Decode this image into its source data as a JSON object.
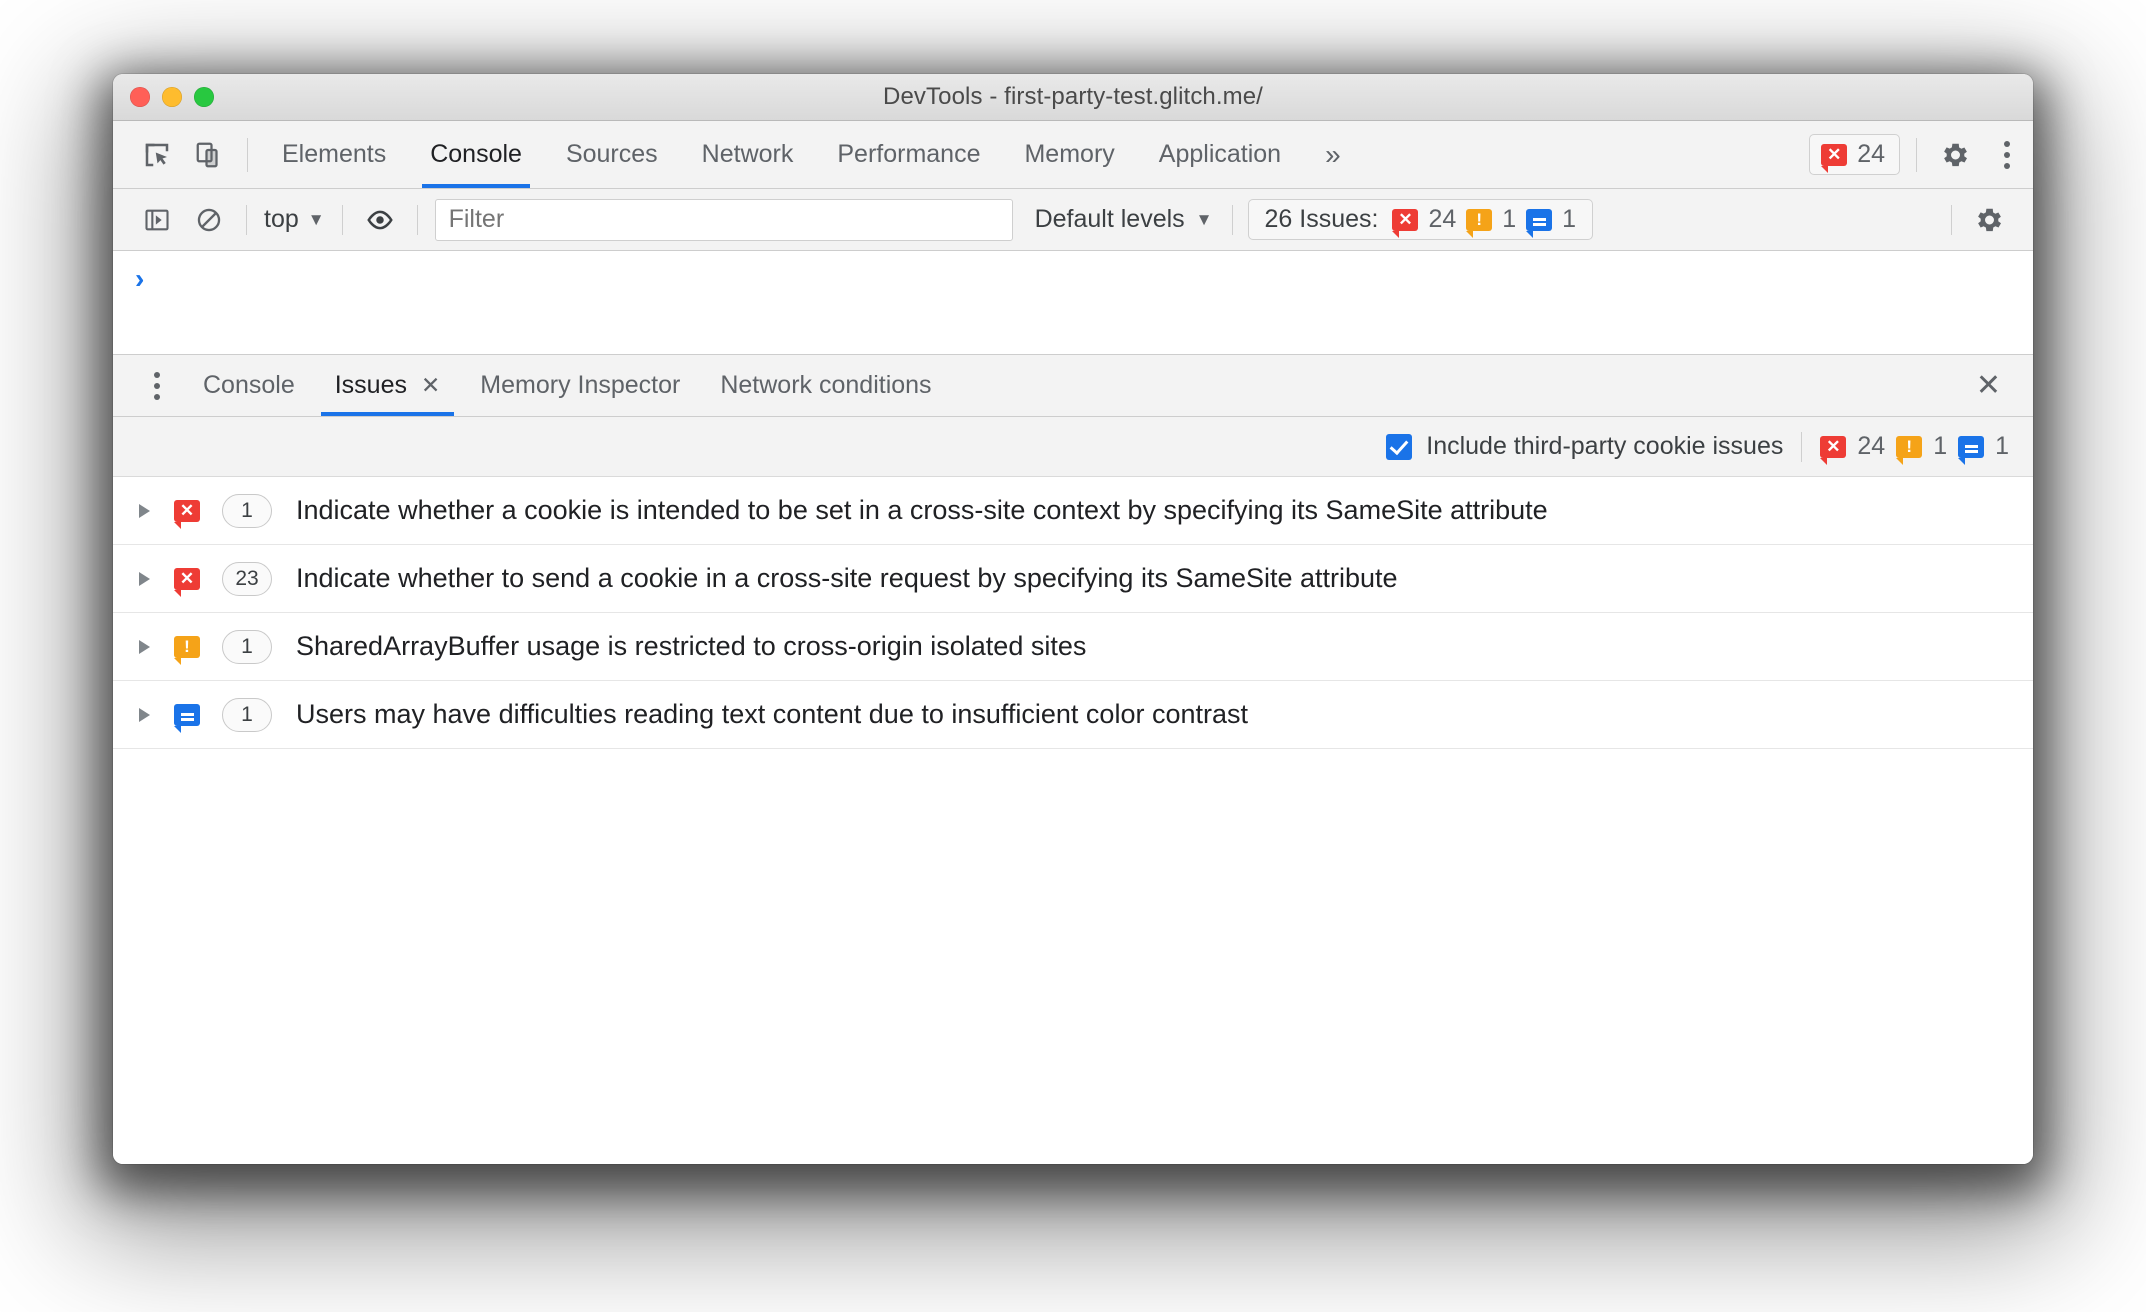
{
  "window": {
    "title": "DevTools - first-party-test.glitch.me/"
  },
  "main_tabs": {
    "items": [
      {
        "label": "Elements",
        "active": false
      },
      {
        "label": "Console",
        "active": true
      },
      {
        "label": "Sources",
        "active": false
      },
      {
        "label": "Network",
        "active": false
      },
      {
        "label": "Performance",
        "active": false
      },
      {
        "label": "Memory",
        "active": false
      },
      {
        "label": "Application",
        "active": false
      }
    ],
    "more_label": "»",
    "error_badge_count": "24"
  },
  "console_toolbar": {
    "context_label": "top",
    "caret": "▼",
    "filter_placeholder": "Filter",
    "levels_label": "Default levels",
    "issues_label": "26 Issues:",
    "issue_counts": {
      "errors": "24",
      "warnings": "1",
      "info": "1"
    }
  },
  "console_pane": {
    "prompt": "›"
  },
  "drawer": {
    "tabs": [
      {
        "label": "Console",
        "active": false,
        "closable": false
      },
      {
        "label": "Issues",
        "active": true,
        "closable": true
      },
      {
        "label": "Memory Inspector",
        "active": false,
        "closable": false
      },
      {
        "label": "Network conditions",
        "active": false,
        "closable": false
      }
    ],
    "close_glyph": "✕",
    "tab_close_glyph": "✕"
  },
  "issues_toolbar": {
    "checkbox_label": "Include third-party cookie issues",
    "checkbox_checked": true,
    "counts": {
      "errors": "24",
      "warnings": "1",
      "info": "1"
    }
  },
  "issues": [
    {
      "severity": "error",
      "count": "1",
      "title": "Indicate whether a cookie is intended to be set in a cross-site context by specifying its SameSite attribute"
    },
    {
      "severity": "error",
      "count": "23",
      "title": "Indicate whether to send a cookie in a cross-site request by specifying its SameSite attribute"
    },
    {
      "severity": "warning",
      "count": "1",
      "title": "SharedArrayBuffer usage is restricted to cross-origin isolated sites"
    },
    {
      "severity": "info",
      "count": "1",
      "title": "Users may have difficulties reading text content due to insufficient color contrast"
    }
  ],
  "colors": {
    "error": "#ee3c35",
    "warning": "#f5a318",
    "info": "#1a73e8",
    "accent": "#1a73e8",
    "toolbar_bg": "#f3f3f3"
  },
  "glyphs": {
    "error_mark": "✕",
    "warning_mark": "!",
    "info_mark": ""
  }
}
